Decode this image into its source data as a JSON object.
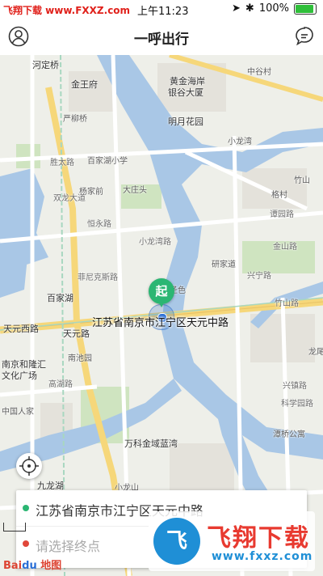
{
  "status_bar": {
    "watermark": "飞翔下载 www.FXXZ.com",
    "time": "上午11:23",
    "battery": "100%",
    "battery_level": 1.0
  },
  "nav": {
    "title": "一呼出行"
  },
  "map": {
    "current_address": "江苏省南京市江宁区天元中路",
    "start_marker": "起",
    "labels": {
      "hedingqiao": "河定桥",
      "jinwangfu": "金王府",
      "huangjinhaian": "黄金海岸",
      "yingguyuan": "银谷大厦",
      "yanliuqiao": "严柳桥",
      "mingyuehuayuan": "明月花园",
      "zhongshancun": "中谷村",
      "shengtailu": "胜太路",
      "baijiahu_school": "百家湖小学",
      "xiaolongwan_n": "小龙湾",
      "zhulin": "竹山",
      "gezhuang": "格村",
      "yangjiaqian": "杨家前",
      "dazhuangtou": "大庄头",
      "tanquanlu": "谭园路",
      "shuanglongdadao": "双龙大道",
      "hengyonglu": "恒永路",
      "xiaolongwanlu": "小龙湾路",
      "jinshanlu": "金山路",
      "feikelu": "菲尼克斯路",
      "lexiangdao": "研家道",
      "xingningl": "兴宁路",
      "baijiahu": "百家湖",
      "shengxu": "圣色",
      "yinglonglu": "竹山路",
      "tianyuanxilu": "天元西路",
      "tianyuanlu": "天元路",
      "longtan": "龙尾",
      "nanjinghelonghui": "南京和隆汇",
      "wenhuaguangchang": "文化广场",
      "nanchiyuan": "南池园",
      "gaohulu": "高湖路",
      "zhongguorenjia": "中国人家",
      "xinzhenlu": "兴镇路",
      "kexuelu": "科学园路",
      "wankejinyu": "万科金域蓝湾",
      "tanjialu": "潭桥公寓",
      "jiulonghu": "九龙湖",
      "xiaolongshan": "小龙山"
    }
  },
  "route": {
    "start_text": "江苏省南京市江宁区天元中路",
    "end_placeholder": "请选择终点",
    "start_color": "#2bb673",
    "end_color": "#e0473a"
  },
  "branding": {
    "baidu": "Bai",
    "baidu_du": "du",
    "baidu_map": "地图",
    "fxxz_logo": "飞",
    "fxxz_name": "飞翔下载",
    "fxxz_url": "www.fxxz.com"
  }
}
